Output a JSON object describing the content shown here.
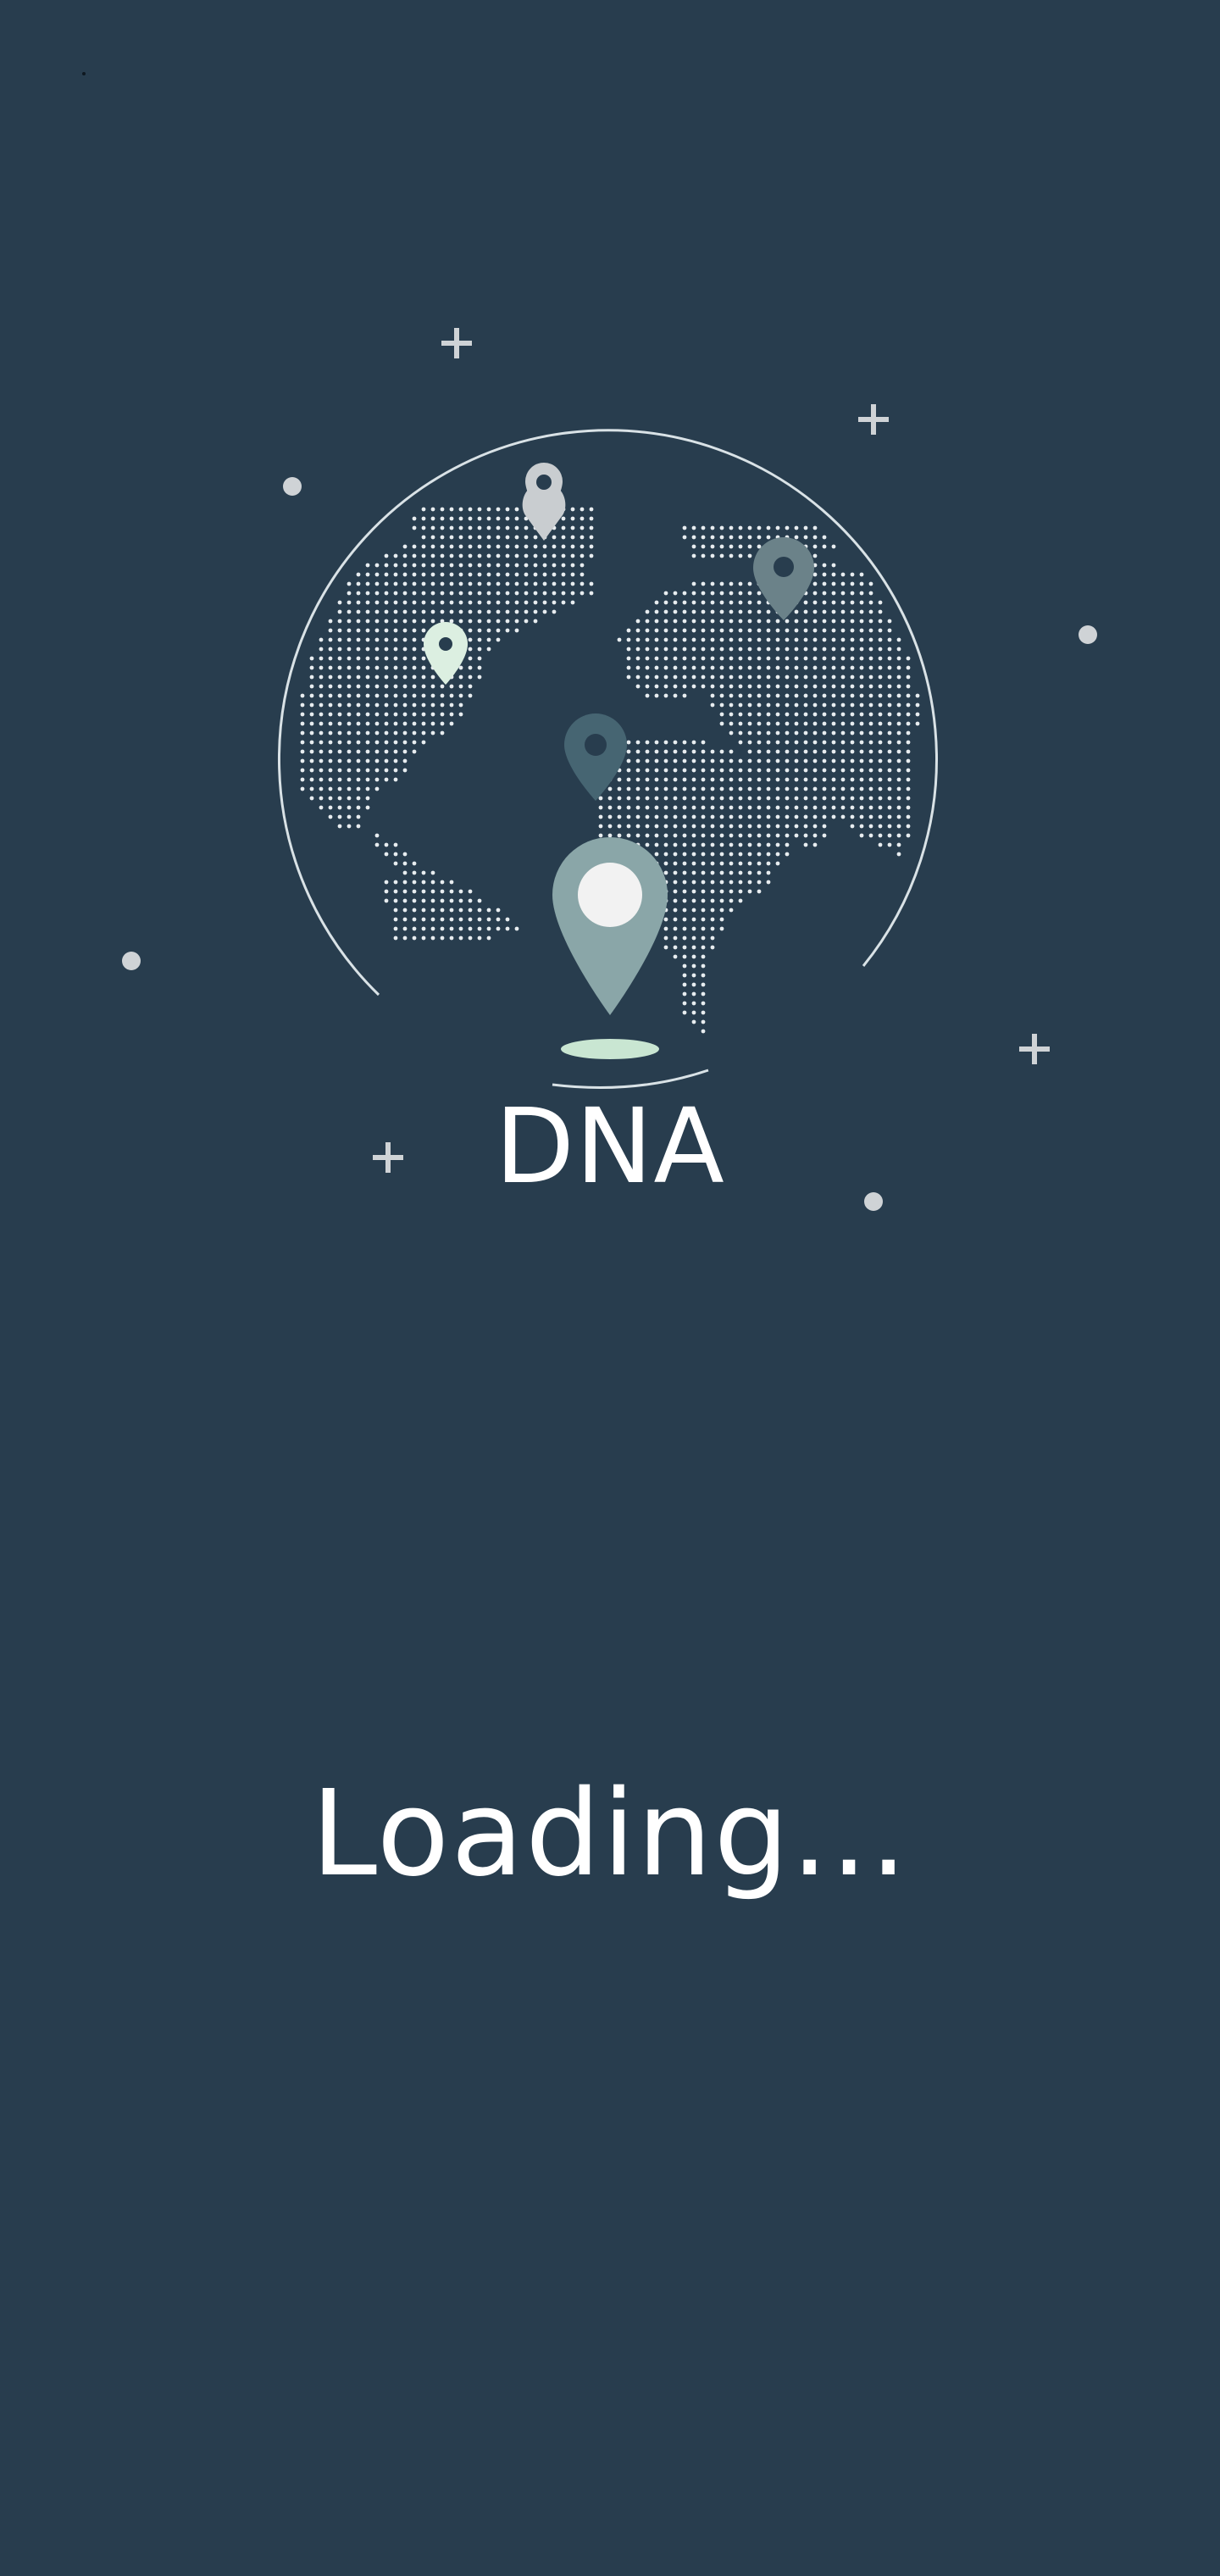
{
  "app": {
    "title": "DNA",
    "status": "Loading..."
  },
  "colors": {
    "background": "#283d4e",
    "globe_outline": "#d9e2e6",
    "dots": "#e8edf0",
    "sparkle": "#cfd3d6",
    "pin_main": "#8aa6a8",
    "pin_main_center": "#f2f2f2",
    "pin_shadow": "#c9e6d2",
    "pin_gray": "#c9cdd0",
    "pin_slate": "#6b8289",
    "pin_mint": "#dcefe1",
    "pin_dark": "#466572",
    "text": "#ffffff"
  },
  "icons": {
    "globe": "dotted-world-map-icon",
    "pins": [
      "location-pin-icon"
    ],
    "sparkles": [
      "plus-sparkle-icon",
      "dot-sparkle-icon"
    ]
  }
}
